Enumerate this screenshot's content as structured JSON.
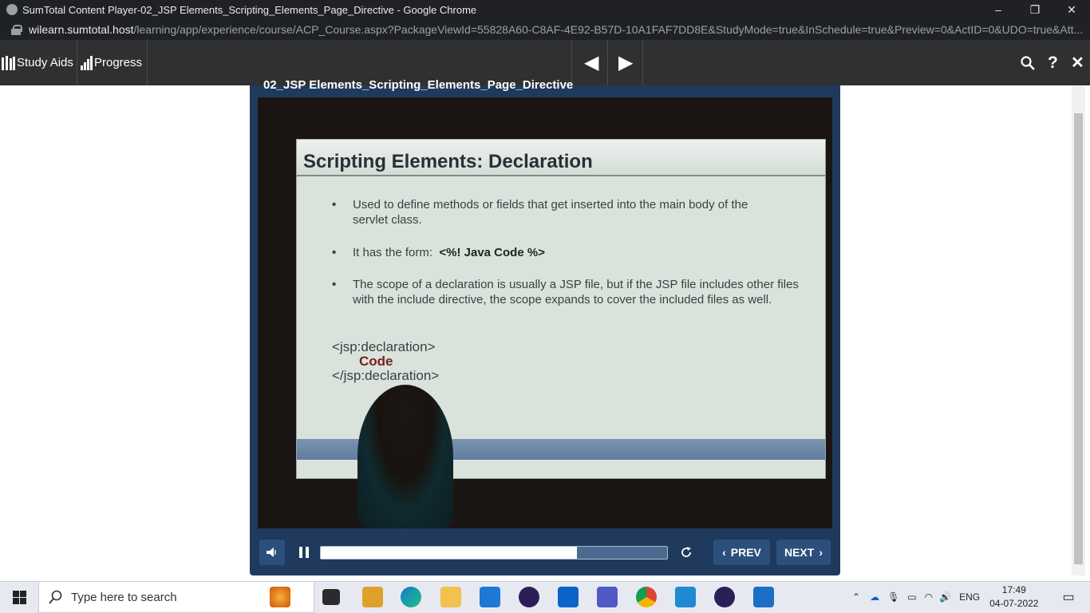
{
  "browser": {
    "window_title": "SumTotal Content Player-02_JSP Elements_Scripting_Elements_Page_Directive - Google Chrome",
    "url_host": "wilearn.sumtotal.host",
    "url_path": "/learning/app/experience/course/ACP_Course.aspx?PackageViewId=55828A60-C8AF-4E92-B57D-10A1FAF7DD8E&StudyMode=true&InSchedule=true&Preview=0&ActID=0&UDO=true&Att...",
    "controls": {
      "minimize": "–",
      "restore": "❐",
      "close": "✕"
    }
  },
  "toolbar": {
    "study_aids": "Study Aids",
    "progress": "Progress",
    "prev_arrow": "◀",
    "next_arrow": "▶",
    "search_glyph": "⚲",
    "help_glyph": "?",
    "close_glyph": "✕"
  },
  "player": {
    "title": "02_JSP Elements_Scripting_Elements_Page_Directive",
    "slide": {
      "title": "Scripting Elements: Declaration",
      "bullets": [
        "Used to  define methods or fields that get inserted into the main body of the servlet class.",
        "It has the  form:",
        "The scope of a declaration is usually a JSP file, but if the JSP file includes other files with the include directive, the scope expands to cover the included files as well."
      ],
      "form_code": "<%! Java Code %>",
      "code": [
        "<jsp:declaration>",
        "Code",
        "</jsp:declaration>"
      ]
    },
    "progress_fraction": 0.74,
    "prev_label": "PREV",
    "next_label": "NEXT"
  },
  "taskbar": {
    "search_placeholder": "Type here to search",
    "language": "ENG",
    "time": "17:49",
    "date": "04-07-2022"
  }
}
